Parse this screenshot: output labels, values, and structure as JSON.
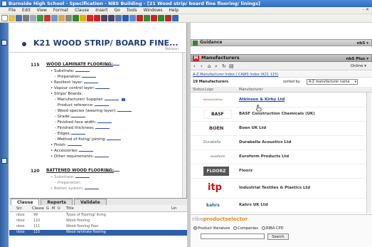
{
  "window": {
    "title": "Burnside High School - Specification - NBS Building - [21 Wood strip/ board fine flooring/ linings]"
  },
  "menu": {
    "items": [
      "File",
      "Edit",
      "View",
      "Format",
      "Clause",
      "Insert",
      "Go",
      "Tools",
      "Windows",
      "Help"
    ],
    "window_controls": "- ✕"
  },
  "document": {
    "section_title": "K21 WOOD STRIP/ BOARD FINE...",
    "revision_label": "Revision",
    "clauses": [
      {
        "num": "115",
        "title": "WOOD LAMINATE FLOORING:",
        "lines": [
          "Substrate:",
          "Preparation:",
          "Resilient layer:",
          "Vapour control layer:",
          "Strips/ Boards:",
          "Manufacturer/ Supplier:",
          "Product reference:",
          "Wood species (wearing layer):",
          "Grade:",
          "Finished face width:",
          "Finished thickness:",
          "Edges:",
          "Method of fixing/ joining:",
          "Finish:",
          "Accessories:",
          "Other requirements:"
        ]
      },
      {
        "num": "120",
        "title": "BATTENED WOOD FLOORING:",
        "lines": [
          "Substrate:",
          "Preparation:",
          "Batten system:"
        ]
      }
    ]
  },
  "tabs": [
    "Clause",
    "Reports",
    "Validate"
  ],
  "clause_list": {
    "headers": [
      "Src",
      "Clause",
      "G",
      "M",
      "U",
      "Title",
      "Lin"
    ],
    "rows": [
      {
        "src": "nbso",
        "clause": "99",
        "title": "Types of flooring/ lining"
      },
      {
        "src": "nbso",
        "clause": "110",
        "title": "Wood flooring"
      },
      {
        "src": "nbso",
        "clause": "111",
        "title": "Wood flooring floor"
      },
      {
        "src": "nbso",
        "clause": "115",
        "title": "Wood laminate flooring"
      }
    ]
  },
  "guidance": {
    "title": "Guidance",
    "right": "nbS ▾"
  },
  "manufacturers": {
    "title": "Manufacturers",
    "right": "nbS Plus ▾",
    "online": "Online ▾",
    "index_links": "A-Z Manufacturer Index | CAWS Index (K21 115)",
    "count": "19 Manufacturers",
    "sorted_label": "sorted by",
    "sort_option": "A-Z manufacturer name",
    "col_status": "Status",
    "col_logo": "Logo",
    "col_manufacturer": "Manufacturer",
    "rows": [
      {
        "name": "Atkinson & Kirby Ltd",
        "logo": "Atkinson&Kirby"
      },
      {
        "name": "BASF Construction Chemicals (UK)",
        "logo": "BASF"
      },
      {
        "name": "Boen UK Ltd",
        "logo": "BOEN"
      },
      {
        "name": "Durabella Acoustics Ltd",
        "logo": "Durabella"
      },
      {
        "name": "Euroform Products Ltd",
        "logo": "euroform"
      },
      {
        "name": "Floorz",
        "logo": "FLOORZ"
      },
      {
        "name": "Industrial Textiles & Plastics Ltd",
        "logo": "itp"
      },
      {
        "name": "Kahrs UK Ltd",
        "logo": "kahrs"
      }
    ]
  },
  "selector": {
    "brand_a": "riba",
    "brand_b": "productselector",
    "options": [
      "Product literature",
      "Companies",
      "RIBA CPD"
    ],
    "search_label": "Search"
  }
}
